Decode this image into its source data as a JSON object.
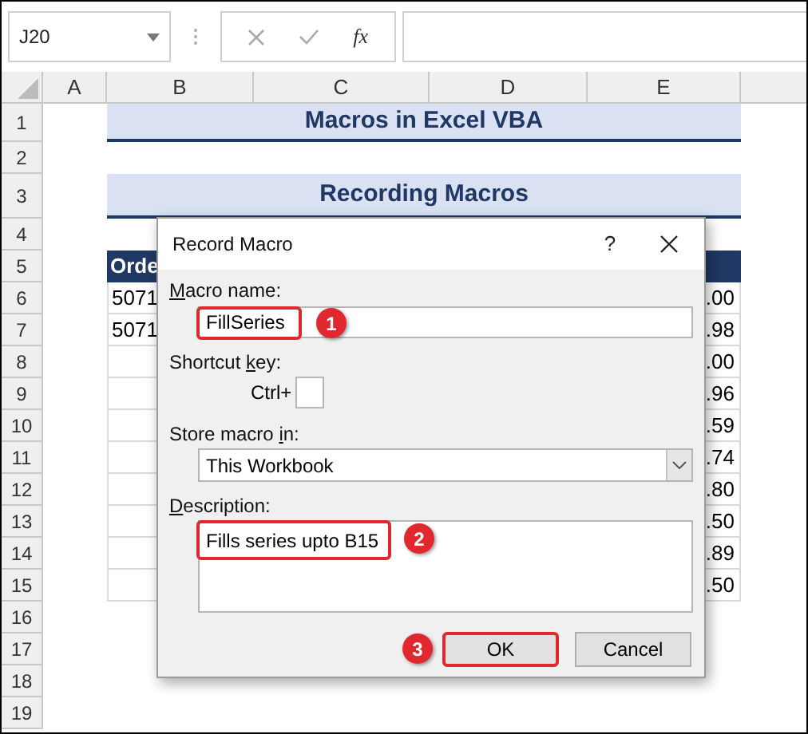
{
  "name_box": {
    "value": "J20"
  },
  "formula_bar": {
    "function_label": "fx"
  },
  "columns": [
    "A",
    "B",
    "C",
    "D",
    "E"
  ],
  "rows": [
    {
      "number": "1",
      "kind": "title",
      "text": "Macros in Excel VBA"
    },
    {
      "number": "2",
      "kind": "blank"
    },
    {
      "number": "3",
      "kind": "subtitle",
      "text": "Recording Macros"
    },
    {
      "number": "4",
      "kind": "blank"
    },
    {
      "number": "5",
      "kind": "header",
      "b": "Orde"
    },
    {
      "number": "6",
      "kind": "data",
      "b": "5071",
      "e": ".00"
    },
    {
      "number": "7",
      "kind": "data",
      "b": "5071",
      "e": ".98"
    },
    {
      "number": "8",
      "kind": "data",
      "e": ".00"
    },
    {
      "number": "9",
      "kind": "data",
      "e": ".96"
    },
    {
      "number": "10",
      "kind": "data",
      "e": ".59"
    },
    {
      "number": "11",
      "kind": "data",
      "e": ".74"
    },
    {
      "number": "12",
      "kind": "data",
      "e": ".80"
    },
    {
      "number": "13",
      "kind": "data",
      "e": ".50"
    },
    {
      "number": "14",
      "kind": "data",
      "e": ".89"
    },
    {
      "number": "15",
      "kind": "data",
      "e": ".50"
    },
    {
      "number": "16",
      "kind": "blank"
    },
    {
      "number": "17",
      "kind": "blank"
    },
    {
      "number": "18",
      "kind": "blank"
    },
    {
      "number": "19",
      "kind": "blank"
    }
  ],
  "dialog": {
    "title": "Record Macro",
    "help": "?",
    "macro_name": {
      "label": {
        "key": "M",
        "after": "acro name:"
      },
      "value": "FillSeries",
      "step": "1"
    },
    "shortcut_key": {
      "label": {
        "before": "Shortcut ",
        "key": "k",
        "after": "ey:"
      },
      "prefix": "Ctrl+"
    },
    "store_in": {
      "label": {
        "before": "Store macro ",
        "key": "i",
        "after": "n:"
      },
      "value": "This Workbook"
    },
    "description": {
      "label": {
        "key": "D",
        "after": "escription:"
      },
      "value": "Fills series upto B15",
      "step": "2"
    },
    "buttons": [
      {
        "label": "OK",
        "default": true,
        "step": "3"
      },
      {
        "label": "Cancel",
        "default": false
      }
    ]
  }
}
